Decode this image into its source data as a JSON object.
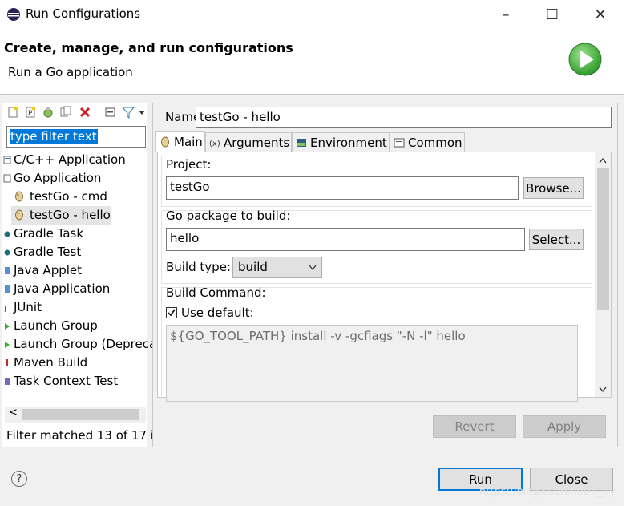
{
  "window": {
    "title": "Run Configurations",
    "minimize": "–",
    "maximize": "☐",
    "close": "✕"
  },
  "header": {
    "title": "Create, manage, and run configurations",
    "subtitle": "Run a Go application"
  },
  "left": {
    "filter_value": "type filter text",
    "status": "Filter matched 13 of 17 i",
    "scroll_left": "<",
    "items": [
      {
        "label": "C/C++ Application",
        "icon": "c-app-icon"
      },
      {
        "label": "Go Application",
        "icon": "go-app-icon"
      },
      {
        "label": "testGo - cmd",
        "icon": "go-config-icon"
      },
      {
        "label": "testGo - hello",
        "icon": "go-config-icon"
      },
      {
        "label": "Gradle Task",
        "icon": "gradle-icon"
      },
      {
        "label": "Gradle Test",
        "icon": "gradle-icon"
      },
      {
        "label": "Java Applet",
        "icon": "applet-icon"
      },
      {
        "label": "Java Application",
        "icon": "java-app-icon"
      },
      {
        "label": "JUnit",
        "icon": "junit-icon"
      },
      {
        "label": "Launch Group",
        "icon": "launch-group-icon"
      },
      {
        "label": "Launch Group (Depreca",
        "icon": "launch-group-icon"
      },
      {
        "label": "Maven Build",
        "icon": "maven-icon"
      },
      {
        "label": "Task Context Test",
        "icon": "task-icon"
      }
    ]
  },
  "right": {
    "name_label": "Name:",
    "name_value": "testGo - hello",
    "tabs": [
      {
        "label": "Main",
        "icon": "main-tab-icon"
      },
      {
        "label": "Arguments",
        "icon": "arguments-tab-icon"
      },
      {
        "label": "Environment",
        "icon": "environment-tab-icon"
      },
      {
        "label": "Common",
        "icon": "common-tab-icon"
      }
    ],
    "project_label": "Project:",
    "project_value": "testGo",
    "browse_label": "Browse...",
    "package_label": "Go package to build:",
    "package_value": "hello",
    "select_label": "Select...",
    "build_type_label": "Build type:",
    "build_type_value": "build",
    "build_command_label": "Build Command:",
    "use_default_label": "Use default:",
    "use_default_checked": true,
    "command_value": "${GO_TOOL_PATH} install -v -gcflags \"-N -l\" hello",
    "revert_label": "Revert",
    "apply_label": "Apply"
  },
  "footer": {
    "help": "?",
    "run_label": "Run",
    "close_label": "Close",
    "watermark": "https://blog.csdn.net/h_fly"
  },
  "colors": {
    "selection": "#0078d7",
    "run_green": "#3aa935"
  }
}
